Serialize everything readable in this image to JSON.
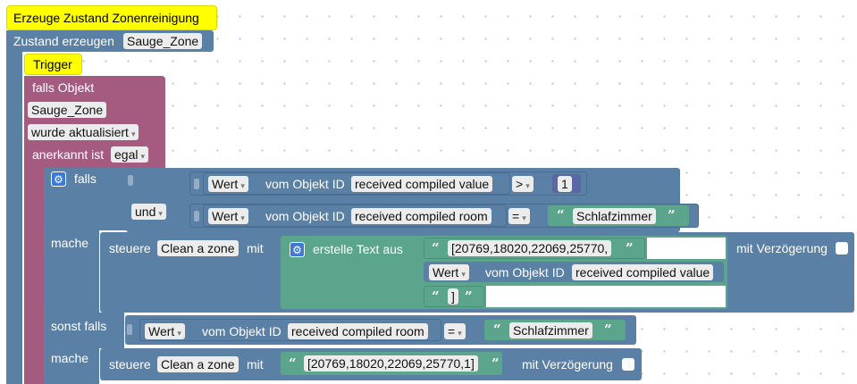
{
  "colors": {
    "event": "#5b80a5",
    "logic": "#a55b80",
    "text": "#5ba58c",
    "hat": "#ffff00"
  },
  "comment": {
    "title": "Erzeuge Zustand Zonenreinigung"
  },
  "state_block": {
    "label": "Zustand erzeugen",
    "name": "Sauge_Zone"
  },
  "trigger": {
    "title": "Trigger",
    "if_object": "falls Objekt",
    "object_id": "Sauge_Zone",
    "updated": "wurde aktualisiert",
    "ack_label": "anerkannt ist",
    "ack_value": "egal",
    "if_label": "falls",
    "do_label": "mache",
    "elseif_label": "sonst falls",
    "do2_label": "mache"
  },
  "cond1": {
    "prop": "Wert",
    "mid": "vom Objekt ID",
    "object": "received compiled value",
    "op": ">",
    "value": "1"
  },
  "and_block": {
    "label": "und"
  },
  "cond2": {
    "prop": "Wert",
    "mid": "vom Objekt ID",
    "object": "received compiled room",
    "op": "=",
    "value": "Schlafzimmer"
  },
  "control1": {
    "label": "steuere",
    "target": "Clean a zone",
    "with": "mit",
    "create_text": "erstelle Text aus",
    "text1": "[20769,18020,22069,25770,",
    "prop": "Wert",
    "mid": "vom Objekt ID",
    "object": "received compiled value",
    "text3": "]",
    "delay": "mit Verzögerung"
  },
  "cond3": {
    "prop": "Wert",
    "mid": "vom Objekt ID",
    "object": "received compiled room",
    "op": "=",
    "value": "Schlafzimmer"
  },
  "control2": {
    "label": "steuere",
    "target": "Clean a zone",
    "with": "mit",
    "text": "[20769,18020,22069,25770,1]",
    "delay": "mit Verzögerung"
  },
  "quote_open": "“",
  "quote_close": "”"
}
